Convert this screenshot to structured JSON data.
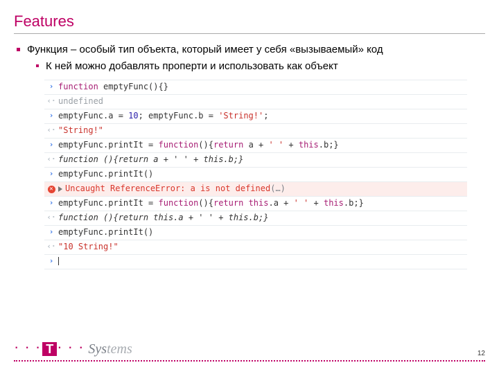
{
  "title": "Features",
  "bullets": {
    "b1": "Функция – особый тип объекта, который имеет у себя «вызываемый» код",
    "b2": "К ней можно добавлять проперти и использовать как объект"
  },
  "console": {
    "rows": [
      {
        "kind": "in",
        "tokens": [
          {
            "t": "function ",
            "c": "k"
          },
          {
            "t": "emptyFunc(){}",
            "c": "fn"
          }
        ]
      },
      {
        "kind": "out",
        "tokens": [
          {
            "t": "undefined",
            "c": "und"
          }
        ]
      },
      {
        "kind": "in",
        "tokens": [
          {
            "t": "emptyFunc.a = ",
            "c": "fn"
          },
          {
            "t": "10",
            "c": "num"
          },
          {
            "t": "; emptyFunc.b = ",
            "c": "fn"
          },
          {
            "t": "'String!'",
            "c": "str"
          },
          {
            "t": ";",
            "c": "fn"
          }
        ]
      },
      {
        "kind": "out",
        "tokens": [
          {
            "t": "\"String!\"",
            "c": "str"
          }
        ]
      },
      {
        "kind": "in",
        "tokens": [
          {
            "t": "emptyFunc.printIt = ",
            "c": "fn"
          },
          {
            "t": "function",
            "c": "k"
          },
          {
            "t": "(){",
            "c": "fn"
          },
          {
            "t": "return",
            "c": "k"
          },
          {
            "t": " a + ",
            "c": "fn"
          },
          {
            "t": "' '",
            "c": "str"
          },
          {
            "t": " + ",
            "c": "fn"
          },
          {
            "t": "this",
            "c": "k"
          },
          {
            "t": ".b;}",
            "c": "fn"
          }
        ]
      },
      {
        "kind": "out",
        "tokens": [
          {
            "t": "function (){return a + ' ' + this.b;}",
            "c": "fout"
          }
        ]
      },
      {
        "kind": "in",
        "tokens": [
          {
            "t": "emptyFunc.printIt()",
            "c": "fn"
          }
        ]
      },
      {
        "kind": "err",
        "tokens": [
          {
            "t": "Uncaught ReferenceError: a is not defined",
            "c": "errtxt"
          },
          {
            "t": "(…)",
            "c": "ellip"
          }
        ]
      },
      {
        "kind": "in",
        "tokens": [
          {
            "t": "emptyFunc.printIt = ",
            "c": "fn"
          },
          {
            "t": "function",
            "c": "k"
          },
          {
            "t": "(){",
            "c": "fn"
          },
          {
            "t": "return",
            "c": "k"
          },
          {
            "t": " ",
            "c": "fn"
          },
          {
            "t": "this",
            "c": "k"
          },
          {
            "t": ".a + ",
            "c": "fn"
          },
          {
            "t": "' '",
            "c": "str"
          },
          {
            "t": " + ",
            "c": "fn"
          },
          {
            "t": "this",
            "c": "k"
          },
          {
            "t": ".b;}",
            "c": "fn"
          }
        ]
      },
      {
        "kind": "out",
        "tokens": [
          {
            "t": "function (){return this.a + ' ' + this.b;}",
            "c": "fout"
          }
        ]
      },
      {
        "kind": "in",
        "tokens": [
          {
            "t": "emptyFunc.printIt()",
            "c": "fn"
          }
        ]
      },
      {
        "kind": "out",
        "tokens": [
          {
            "t": "\"10 String!\"",
            "c": "str"
          }
        ]
      },
      {
        "kind": "prompt",
        "tokens": []
      }
    ]
  },
  "footer": {
    "dots": "· · ·",
    "T": "T",
    "systems_dark": "Sys",
    "systems_light": "tems",
    "page": "12"
  }
}
